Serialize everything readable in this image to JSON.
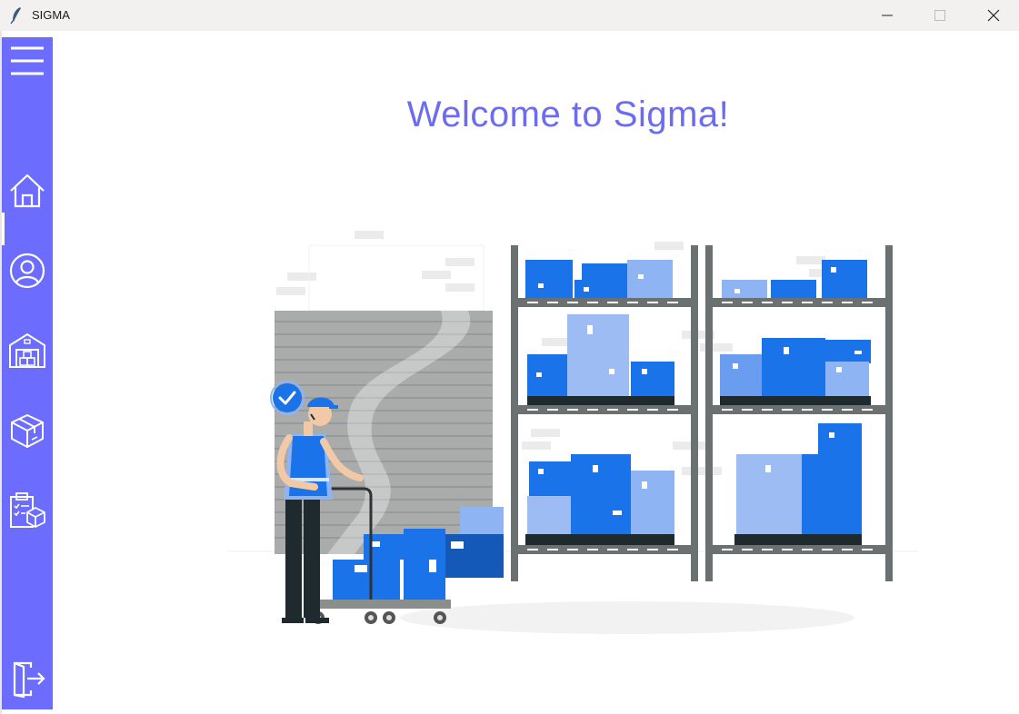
{
  "window": {
    "title": "SIGMA"
  },
  "sidebar": {
    "items": [
      {
        "name": "menu",
        "icon": "hamburger-menu-icon"
      },
      {
        "name": "home",
        "icon": "home-icon",
        "active": true
      },
      {
        "name": "profile",
        "icon": "user-circle-icon"
      },
      {
        "name": "warehouse",
        "icon": "warehouse-icon"
      },
      {
        "name": "products",
        "icon": "package-box-icon"
      },
      {
        "name": "inventory",
        "icon": "clipboard-inventory-icon"
      },
      {
        "name": "logout",
        "icon": "logout-door-icon"
      }
    ],
    "color": "#6c6cff"
  },
  "main": {
    "welcome_text": "Welcome to Sigma!",
    "welcome_color": "#6c6cf0",
    "illustration": "warehouse-worker-illustration"
  }
}
